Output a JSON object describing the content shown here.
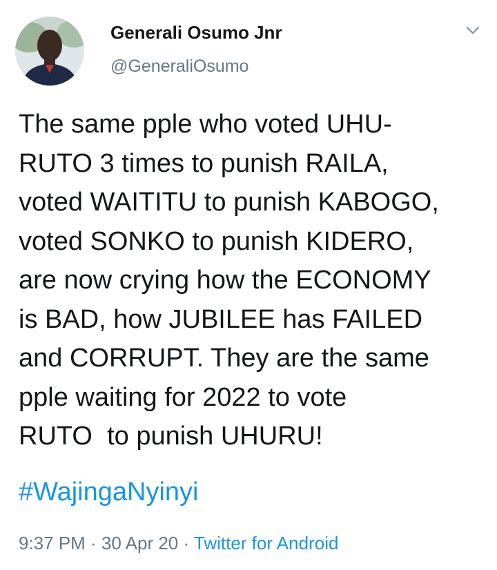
{
  "tweet": {
    "author": {
      "name": "Generali Osumo Jnr",
      "handle": "@GeneraliOsumo",
      "avatar_icon": "profile-photo"
    },
    "menu_icon": "chevron-down-icon",
    "text_lines": [
      "The same pple who voted UHU-",
      "RUTO 3 times to punish RAILA,",
      "voted WAITITU to punish KABOGO,",
      "voted SONKO to punish KIDERO,",
      "are now crying how the ECONOMY",
      "is BAD, how JUBILEE has FAILED",
      "and CORRUPT. They are the same",
      "pple waiting for 2022 to vote",
      "RUTO  to punish UHURU!"
    ],
    "hashtag": "#WajingaNyinyi",
    "time": "9:37 PM",
    "separator": " · ",
    "date": "30 Apr 20",
    "source": "Twitter for Android"
  },
  "colors": {
    "text": "#14171a",
    "secondary": "#657786",
    "link": "#1b95e0",
    "background": "#ffffff"
  }
}
